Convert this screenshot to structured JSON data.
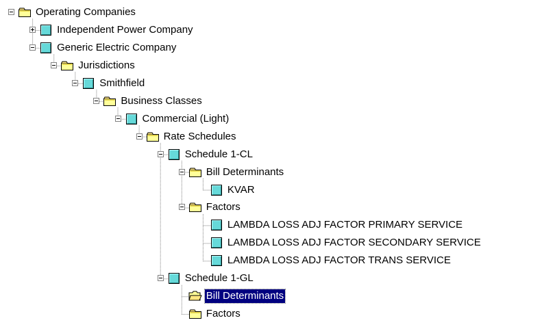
{
  "tree": {
    "selected_id": "bd2",
    "nodes": [
      {
        "id": "root",
        "label": "Operating Companies",
        "type": "folder",
        "expanded": true,
        "depth": 0
      },
      {
        "id": "ipc",
        "label": "Independent Power Company",
        "type": "entity",
        "expanded": false,
        "depth": 1
      },
      {
        "id": "gec",
        "label": "Generic Electric Company",
        "type": "entity",
        "expanded": true,
        "depth": 1
      },
      {
        "id": "jur",
        "label": "Jurisdictions",
        "type": "folder",
        "expanded": true,
        "depth": 2
      },
      {
        "id": "smith",
        "label": "Smithfield",
        "type": "entity",
        "expanded": true,
        "depth": 3
      },
      {
        "id": "bc",
        "label": "Business Classes",
        "type": "folder",
        "expanded": true,
        "depth": 4
      },
      {
        "id": "comm",
        "label": "Commercial (Light)",
        "type": "entity",
        "expanded": true,
        "depth": 5
      },
      {
        "id": "rs",
        "label": "Rate Schedules",
        "type": "folder",
        "expanded": true,
        "depth": 6
      },
      {
        "id": "s1cl",
        "label": "Schedule 1-CL",
        "type": "entity",
        "expanded": true,
        "depth": 7
      },
      {
        "id": "bd1",
        "label": "Bill Determinants",
        "type": "folder",
        "expanded": true,
        "depth": 8
      },
      {
        "id": "kvar",
        "label": "KVAR",
        "type": "entity",
        "expanded": null,
        "depth": 9
      },
      {
        "id": "fac1",
        "label": "Factors",
        "type": "folder",
        "expanded": true,
        "depth": 8
      },
      {
        "id": "lp",
        "label": "LAMBDA LOSS ADJ FACTOR PRIMARY SERVICE",
        "type": "entity",
        "expanded": null,
        "depth": 9
      },
      {
        "id": "ls",
        "label": "LAMBDA LOSS ADJ FACTOR SECONDARY SERVICE",
        "type": "entity",
        "expanded": null,
        "depth": 9
      },
      {
        "id": "lt",
        "label": "LAMBDA LOSS ADJ FACTOR TRANS SERVICE",
        "type": "entity",
        "expanded": null,
        "depth": 9
      },
      {
        "id": "s1gl",
        "label": "Schedule 1-GL",
        "type": "entity",
        "expanded": true,
        "depth": 7
      },
      {
        "id": "bd2",
        "label": "Bill Determinants",
        "type": "folder-open",
        "expanded": null,
        "depth": 8
      },
      {
        "id": "fac2",
        "label": "Factors",
        "type": "folder",
        "expanded": null,
        "depth": 8
      }
    ]
  },
  "icon_names": {
    "folder": "folder-icon",
    "folder-open": "open-folder-icon",
    "entity": "entity-icon"
  },
  "colors": {
    "folder_fill": "#FFFF99",
    "folder_tab": "#FFE680",
    "entity_fill": "#66D9D9",
    "selection": "#000080",
    "tree_line": "#808080"
  }
}
